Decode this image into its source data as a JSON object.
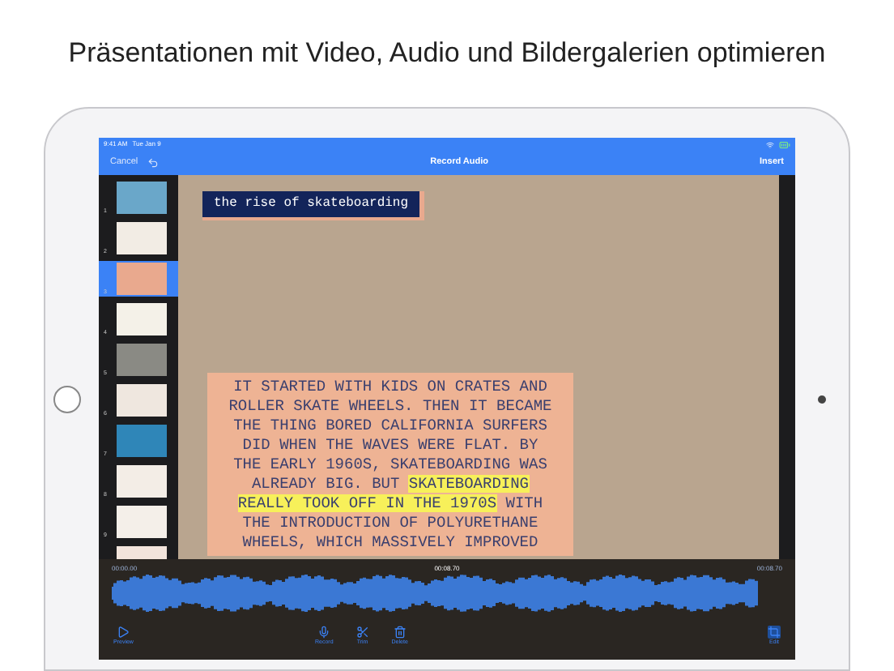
{
  "headline": "Präsentationen mit Video, Audio und Bildergalerien optimieren",
  "status_bar": {
    "time": "9:41 AM",
    "date": "Tue Jan 9"
  },
  "nav_bar": {
    "cancel": "Cancel",
    "title": "Record Audio",
    "insert": "Insert"
  },
  "slides": [
    {
      "number": "1",
      "color": "#6aa7c9",
      "selected": false
    },
    {
      "number": "2",
      "color": "#f2ece4",
      "selected": false
    },
    {
      "number": "3",
      "color": "#e9a98e",
      "selected": true
    },
    {
      "number": "4",
      "color": "#f4f1e8",
      "selected": false
    },
    {
      "number": "5",
      "color": "#8a8a84",
      "selected": false
    },
    {
      "number": "6",
      "color": "#efe7df",
      "selected": false
    },
    {
      "number": "7",
      "color": "#2f86b8",
      "selected": false
    },
    {
      "number": "8",
      "color": "#f3ede6",
      "selected": false
    },
    {
      "number": "9",
      "color": "#f4efe9",
      "selected": false
    },
    {
      "color": "#f2e4dc",
      "selected": false
    }
  ],
  "slide": {
    "title": "the rise of skateboarding",
    "text_before": "IT STARTED WITH KIDS ON CRATES AND ROLLER SKATE WHEELS. THEN IT BECAME THE THING BORED CALIFORNIA SURFERS DID WHEN THE WAVES WERE FLAT. BY THE EARLY 1960S, SKATEBOARDING WAS ALREADY BIG. BUT ",
    "text_highlight": "SKATEBOARDING REALLY TOOK OFF IN THE 1970S",
    "text_after": " WITH THE INTRODUCTION OF POLYURETHANE WHEELS, WHICH MASSIVELY IMPROVED"
  },
  "audio": {
    "start_time": "00:00.00",
    "current_time": "00:08.70",
    "end_time": "00:08.70"
  },
  "toolbar": [
    {
      "kind": "play",
      "label": "Preview",
      "selected": false
    },
    {
      "kind": "mic",
      "label": "Record",
      "selected": false
    },
    {
      "kind": "scissors",
      "label": "Trim",
      "selected": false
    },
    {
      "kind": "trash",
      "label": "Delete",
      "selected": false
    },
    {
      "kind": "crop",
      "label": "Edit",
      "selected": true
    }
  ]
}
